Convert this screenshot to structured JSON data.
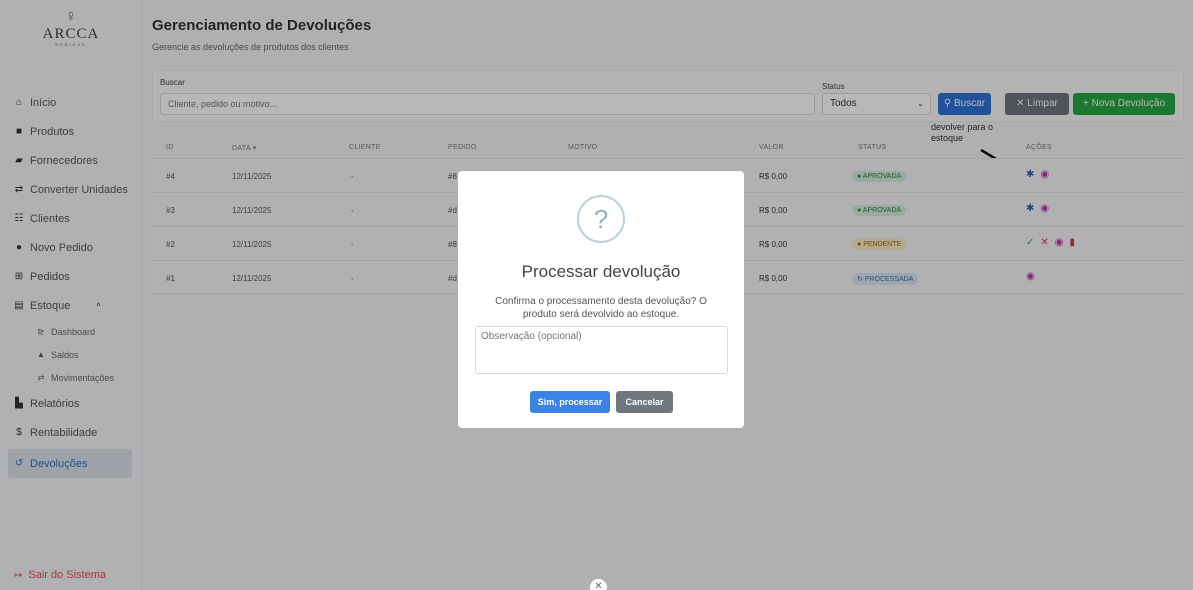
{
  "brand": {
    "glass_icon": "wine-glass-icon",
    "name": "ARCCA",
    "sub": "BEBIDAS"
  },
  "sidebar": {
    "items": [
      {
        "label": "Início",
        "icon": "home-icon"
      },
      {
        "label": "Produtos",
        "icon": "box-icon"
      },
      {
        "label": "Fornecedores",
        "icon": "truck-icon"
      },
      {
        "label": "Converter Unidades",
        "icon": "exchange-icon"
      },
      {
        "label": "Clientes",
        "icon": "users-icon"
      },
      {
        "label": "Novo Pedido",
        "icon": "plus-circle-icon"
      },
      {
        "label": "Pedidos",
        "icon": "cart-icon"
      },
      {
        "label": "Estoque",
        "icon": "warehouse-icon"
      },
      {
        "label": "Dashboard",
        "icon": "chart-icon"
      },
      {
        "label": "Saldos",
        "icon": "boxes-icon"
      },
      {
        "label": "Movimentações",
        "icon": "exchange-icon"
      },
      {
        "label": "Relatórios",
        "icon": "report-icon"
      },
      {
        "label": "Rentabilidade",
        "icon": "dollar-icon"
      },
      {
        "label": "Devoluções",
        "icon": "undo-icon"
      }
    ],
    "logout": "Sair do Sistema"
  },
  "header": {
    "title": "Gerenciamento de Devoluções",
    "subtitle": "Gerencie as devoluções de produtos dos clientes"
  },
  "filters": {
    "search_label": "Buscar",
    "search_placeholder": "Cliente, pedido ou motivo...",
    "status_label": "Status",
    "status_value": "Todos",
    "buscar_btn": "Buscar",
    "limpar_btn": "Limpar",
    "nova_btn": "Nova Devolução"
  },
  "annotation": {
    "line1": "devolver para o",
    "line2": "estoque"
  },
  "table": {
    "headers": [
      "ID",
      "DATA",
      "CLIENTE",
      "PEDIDO",
      "MOTIVO",
      "VALOR",
      "STATUS",
      "AÇÕES"
    ],
    "rows": [
      {
        "id": "#4",
        "date": "12/11/2025",
        "client": "-",
        "order": "#8",
        "value": "R$ 0,00",
        "status": "APROVADA"
      },
      {
        "id": "#3",
        "date": "12/11/2025",
        "client": "-",
        "order": "#d",
        "value": "R$ 0,00",
        "status": "APROVADA"
      },
      {
        "id": "#2",
        "date": "12/11/2025",
        "client": "-",
        "order": "#8",
        "value": "R$ 0,00",
        "status": "PENDENTE"
      },
      {
        "id": "#1",
        "date": "12/11/2025",
        "client": "-",
        "order": "#d",
        "value": "R$ 0,00",
        "status": "PROCESSADA"
      }
    ]
  },
  "modal": {
    "icon": "question-icon",
    "title": "Processar devolução",
    "text": "Confirma o processamento desta devolução? O produto será devolvido ao estoque.",
    "placeholder": "Observação (opcional)",
    "confirm": "Sim, processar",
    "cancel": "Cancelar"
  }
}
